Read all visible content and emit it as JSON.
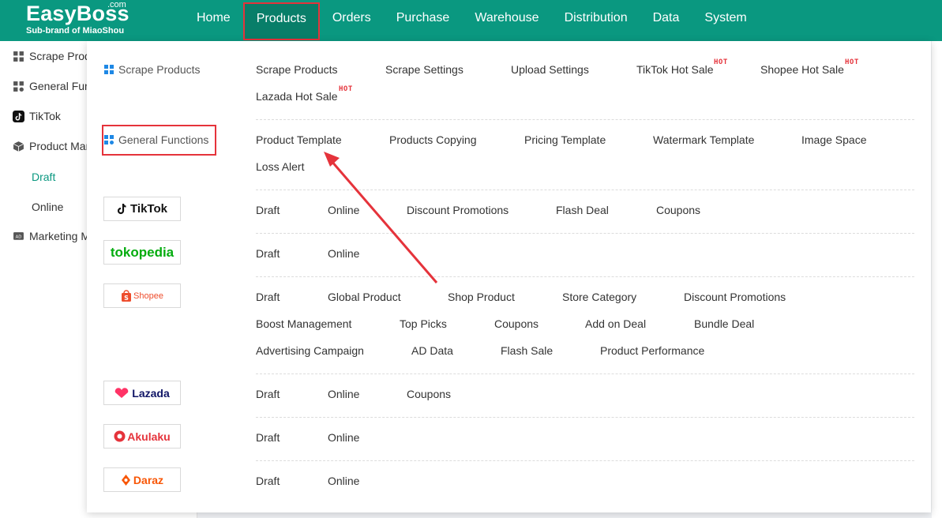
{
  "app": {
    "logo_main": "EasyBoss",
    "logo_com": ".com",
    "logo_sub": "Sub-brand of MiaoShou"
  },
  "nav": {
    "items": [
      "Home",
      "Products",
      "Orders",
      "Purchase",
      "Warehouse",
      "Distribution",
      "Data",
      "System"
    ],
    "active": "Products"
  },
  "sidebar": {
    "items": [
      {
        "label": "Scrape Products",
        "icon": "grid-icon"
      },
      {
        "label": "General Functions",
        "icon": "grid-icon"
      },
      {
        "label": "TikTok",
        "icon": "tiktok-icon"
      },
      {
        "label": "Product Management",
        "icon": "box-icon"
      },
      {
        "label": "Marketing Management",
        "icon": "ad-icon"
      }
    ],
    "sub_items": [
      {
        "label": "Draft",
        "active": true
      },
      {
        "label": "Online",
        "active": false
      }
    ]
  },
  "menu": {
    "scrape": {
      "category": "Scrape Products",
      "links": [
        "Scrape Products",
        "Scrape Settings",
        "Upload Settings",
        "TikTok Hot Sale",
        "Shopee Hot Sale",
        "Lazada Hot Sale"
      ],
      "hot_label": "HOT"
    },
    "general": {
      "category": "General Functions",
      "links": [
        "Product Template",
        "Products Copying",
        "Pricing Template",
        "Watermark Template",
        "Image Space",
        "Loss Alert"
      ]
    },
    "tiktok": {
      "brand": "TikTok",
      "links": [
        "Draft",
        "Online",
        "Discount Promotions",
        "Flash Deal",
        "Coupons"
      ]
    },
    "tokopedia": {
      "brand": "tokopedia",
      "links": [
        "Draft",
        "Online"
      ]
    },
    "shopee": {
      "brand": "Shopee",
      "links": [
        "Draft",
        "Global Product",
        "Shop Product",
        "Store Category",
        "Discount Promotions",
        "Boost Management",
        "Top Picks",
        "Coupons",
        "Add on Deal",
        "Bundle Deal",
        "Advertising Campaign",
        "AD Data",
        "Flash Sale",
        "Product Performance"
      ]
    },
    "lazada": {
      "brand": "Lazada",
      "links": [
        "Draft",
        "Online",
        "Coupons"
      ]
    },
    "akulaku": {
      "brand": "Akulaku",
      "links": [
        "Draft",
        "Online"
      ]
    },
    "daraz": {
      "brand": "Daraz",
      "links": [
        "Draft",
        "Online"
      ]
    }
  },
  "colors": {
    "brand": "#0a9880",
    "highlight": "#e5333b",
    "tiktok": "#000000",
    "tokopedia": "#03ac0e",
    "shopee": "#ee4d2d",
    "lazada": "#101566",
    "akulaku": "#e5333b",
    "daraz": "#f85606"
  }
}
